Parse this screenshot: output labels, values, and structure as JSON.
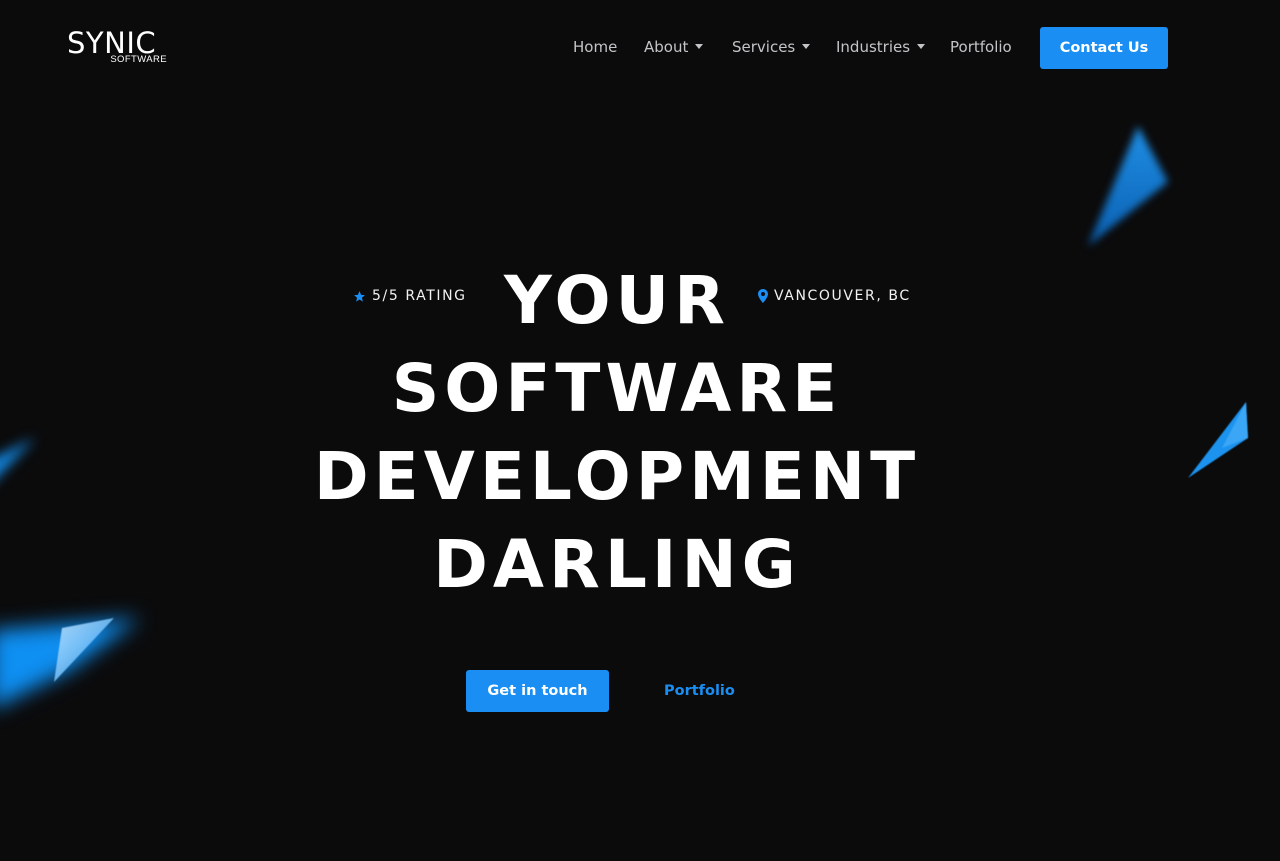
{
  "brand": {
    "name": "SYNIC",
    "sub": "SOFTWARE"
  },
  "nav": {
    "items": [
      {
        "label": "Home",
        "dropdown": false
      },
      {
        "label": "About",
        "dropdown": true
      },
      {
        "label": "Services",
        "dropdown": true
      },
      {
        "label": "Industries",
        "dropdown": true
      },
      {
        "label": "Portfolio",
        "dropdown": false
      }
    ],
    "cta_label": "Contact Us"
  },
  "hero": {
    "rating": "5/5 RATING",
    "location": "VANCOUVER, BC",
    "title_lines": [
      "YOUR",
      "SOFTWARE",
      "DEVELOPMENT",
      "DARLING"
    ],
    "primary_button": "Get in touch",
    "secondary_link": "Portfolio"
  },
  "icons": {
    "rating": "star-icon",
    "location": "map-pin-icon"
  },
  "colors": {
    "background": "#0b0b0c",
    "accent": "#1a8ef2",
    "text": "#ffffff",
    "nav_text": "#c4c4c8"
  }
}
